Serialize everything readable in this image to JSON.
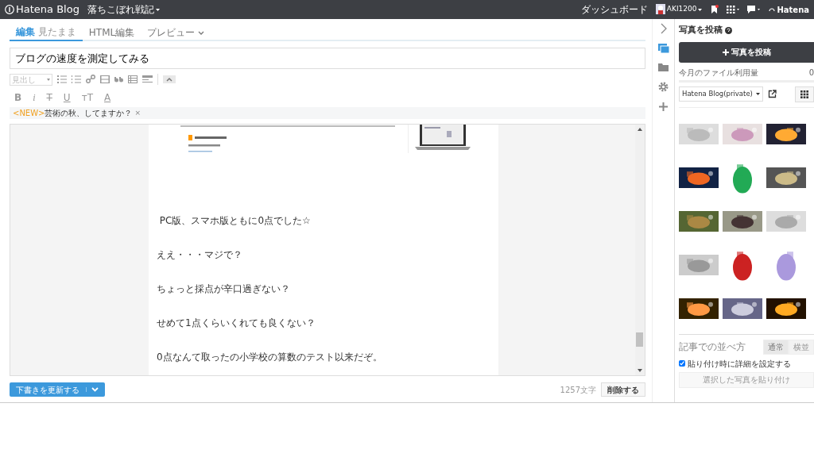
{
  "topbar": {
    "logo": "Hatena Blog",
    "blog_name": "落ちこぼれ戦記",
    "dashboard": "ダッシュボード",
    "user": "AKI1200",
    "brand_cut": "Hatena"
  },
  "tabs": [
    {
      "label": "編集",
      "sub": "見たまま",
      "selected": true
    },
    {
      "label": "HTML編集",
      "selected": false
    },
    {
      "label": "プレビュー",
      "selected": false
    }
  ],
  "title_field": {
    "value": "ブログの速度を測定してみる"
  },
  "heading_select": {
    "value": "見出し"
  },
  "format_buttons": [
    {
      "label": "B",
      "kind": "bold"
    },
    {
      "label": "i",
      "kind": "italic"
    },
    {
      "label": "T",
      "kind": "strike"
    },
    {
      "label": "U",
      "kind": "underline"
    },
    {
      "label": "тT",
      "kind": "size"
    },
    {
      "label": "A",
      "kind": "color"
    }
  ],
  "notice": {
    "tag": "<NEW>",
    "text": "芸術の秋、してますか？",
    "close": "×"
  },
  "paragraphs": [
    " PC版、スマホ版ともに0点でした☆",
    "ええ・・・マジで？",
    "ちょっと採点が辛口過ぎない？",
    "せめて1点くらいくれても良くない？",
    "0点なんて取ったの小学校の算数のテスト以来だぞ。"
  ],
  "footer": {
    "save": "下書きを更新する",
    "count": "1257文字",
    "delete": "削除する"
  },
  "sidebar": {
    "title": "写真を投稿",
    "upload": "写真を投稿",
    "usage_label": "今月のファイル利用量",
    "usage_value": "0",
    "album": "Hatena Blog(private)",
    "arrange_label": "記事での並べ方",
    "arrange_options": [
      {
        "label": "通常",
        "selected": true
      },
      {
        "label": "横並",
        "selected": false
      }
    ],
    "detail_checkbox": {
      "label": "貼り付け時に詳細を設定する",
      "checked": true
    },
    "paste": "選択した写真を貼り付け"
  }
}
